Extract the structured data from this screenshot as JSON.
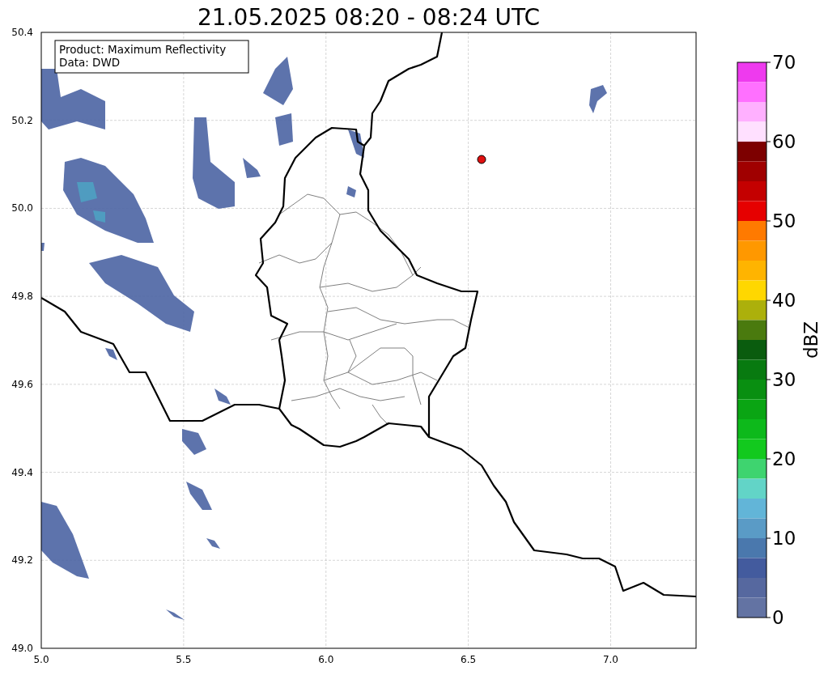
{
  "title": "21.05.2025 08:20 - 08:24 UTC",
  "info_box": {
    "lines": [
      "Product: Maximum Reflectivity",
      "Data: DWD"
    ]
  },
  "map": {
    "x_ticks": [
      "5.0",
      "5.5",
      "6.0",
      "6.5",
      "7.0"
    ],
    "y_ticks": [
      "50.4",
      "50.2",
      "50.0",
      "49.8",
      "49.6",
      "49.4",
      "49.2",
      "49.0"
    ]
  },
  "colorbar": {
    "label": "dBZ",
    "ticks": [
      "70",
      "60",
      "50",
      "40",
      "30",
      "20",
      "10",
      "0"
    ],
    "bands": [
      {
        "color": "#ee3aee"
      },
      {
        "color": "#ff70ff"
      },
      {
        "color": "#ffb0ff"
      },
      {
        "color": "#ffe0ff"
      },
      {
        "color": "#7d0000"
      },
      {
        "color": "#a00000"
      },
      {
        "color": "#c40000"
      },
      {
        "color": "#e60000"
      },
      {
        "color": "#ff7a00"
      },
      {
        "color": "#ff9800"
      },
      {
        "color": "#ffb400"
      },
      {
        "color": "#ffd700"
      },
      {
        "color": "#acb00b"
      },
      {
        "color": "#4a7a0e"
      },
      {
        "color": "#0a5c0e"
      },
      {
        "color": "#087a10"
      },
      {
        "color": "#098f11"
      },
      {
        "color": "#0aa513"
      },
      {
        "color": "#0db91b"
      },
      {
        "color": "#12c91e"
      },
      {
        "color": "#3ed46f"
      },
      {
        "color": "#62d4c7"
      },
      {
        "color": "#62b5d8"
      },
      {
        "color": "#5a9bc6"
      },
      {
        "color": "#4a78ad"
      },
      {
        "color": "#435b9e"
      },
      {
        "color": "#56689f"
      },
      {
        "color": "#6373a3"
      }
    ]
  }
}
